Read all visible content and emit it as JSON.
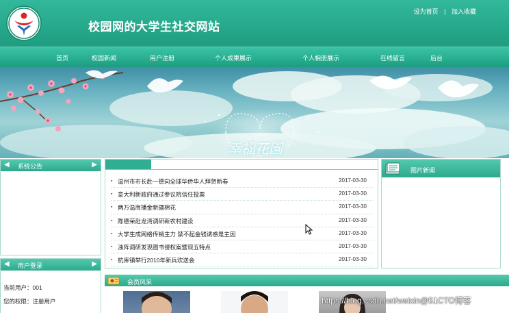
{
  "header": {
    "site_title": "校园网的大学生社交网站",
    "links": [
      "设为首页",
      "加入收藏"
    ],
    "link_separator": "|"
  },
  "nav": {
    "items": [
      "首页",
      "校园新闻",
      "用户注册",
      "个人成果展示",
      "个人相册展示",
      "在线留言",
      "后台"
    ]
  },
  "banner": {
    "overlay_text": "幸福花園"
  },
  "sidebar": {
    "notice_title": "系统公告",
    "login_title": "用户登录",
    "current_user_label": "当前用户：001",
    "permission_label": "您的权限：注册用户"
  },
  "news": {
    "items": [
      {
        "title": "温州市市长赴一德向全球华侨华人拜贺新春",
        "date": "2017-03-30"
      },
      {
        "title": "意大利新政府通过参议院信任投票",
        "date": "2017-03-30"
      },
      {
        "title": "两万温商播金新疆棉花",
        "date": "2017-03-30"
      },
      {
        "title": "陈德荣赴龙湾调研新农村建设",
        "date": "2017-03-30"
      },
      {
        "title": "大学生成网络传销主力 禁不起金钱诱惑是主因",
        "date": "2017-03-30"
      },
      {
        "title": "浊阵调研发现图书侵权案暨现五特点",
        "date": "2017-03-30"
      },
      {
        "title": "杭库镇举行2010年新兵欢送会",
        "date": "2017-03-30"
      }
    ]
  },
  "pictures": {
    "title": "图片新闻"
  },
  "members": {
    "title": "会员风采"
  },
  "watermark": {
    "text": "https://blog.csdn.net/weixin@51CTO博客"
  },
  "colors": {
    "primary": "#2cae91",
    "nav_bg": "#27ad8f",
    "panel_border": "#a7d9cc",
    "logo_red": "#d9252a",
    "logo_blue": "#1e6fb8"
  },
  "icons": [
    "logo-icon",
    "left-arrow-icon",
    "right-arrow-icon",
    "bullet-icon",
    "book-icon",
    "members-icon",
    "mouse-cursor-icon"
  ]
}
